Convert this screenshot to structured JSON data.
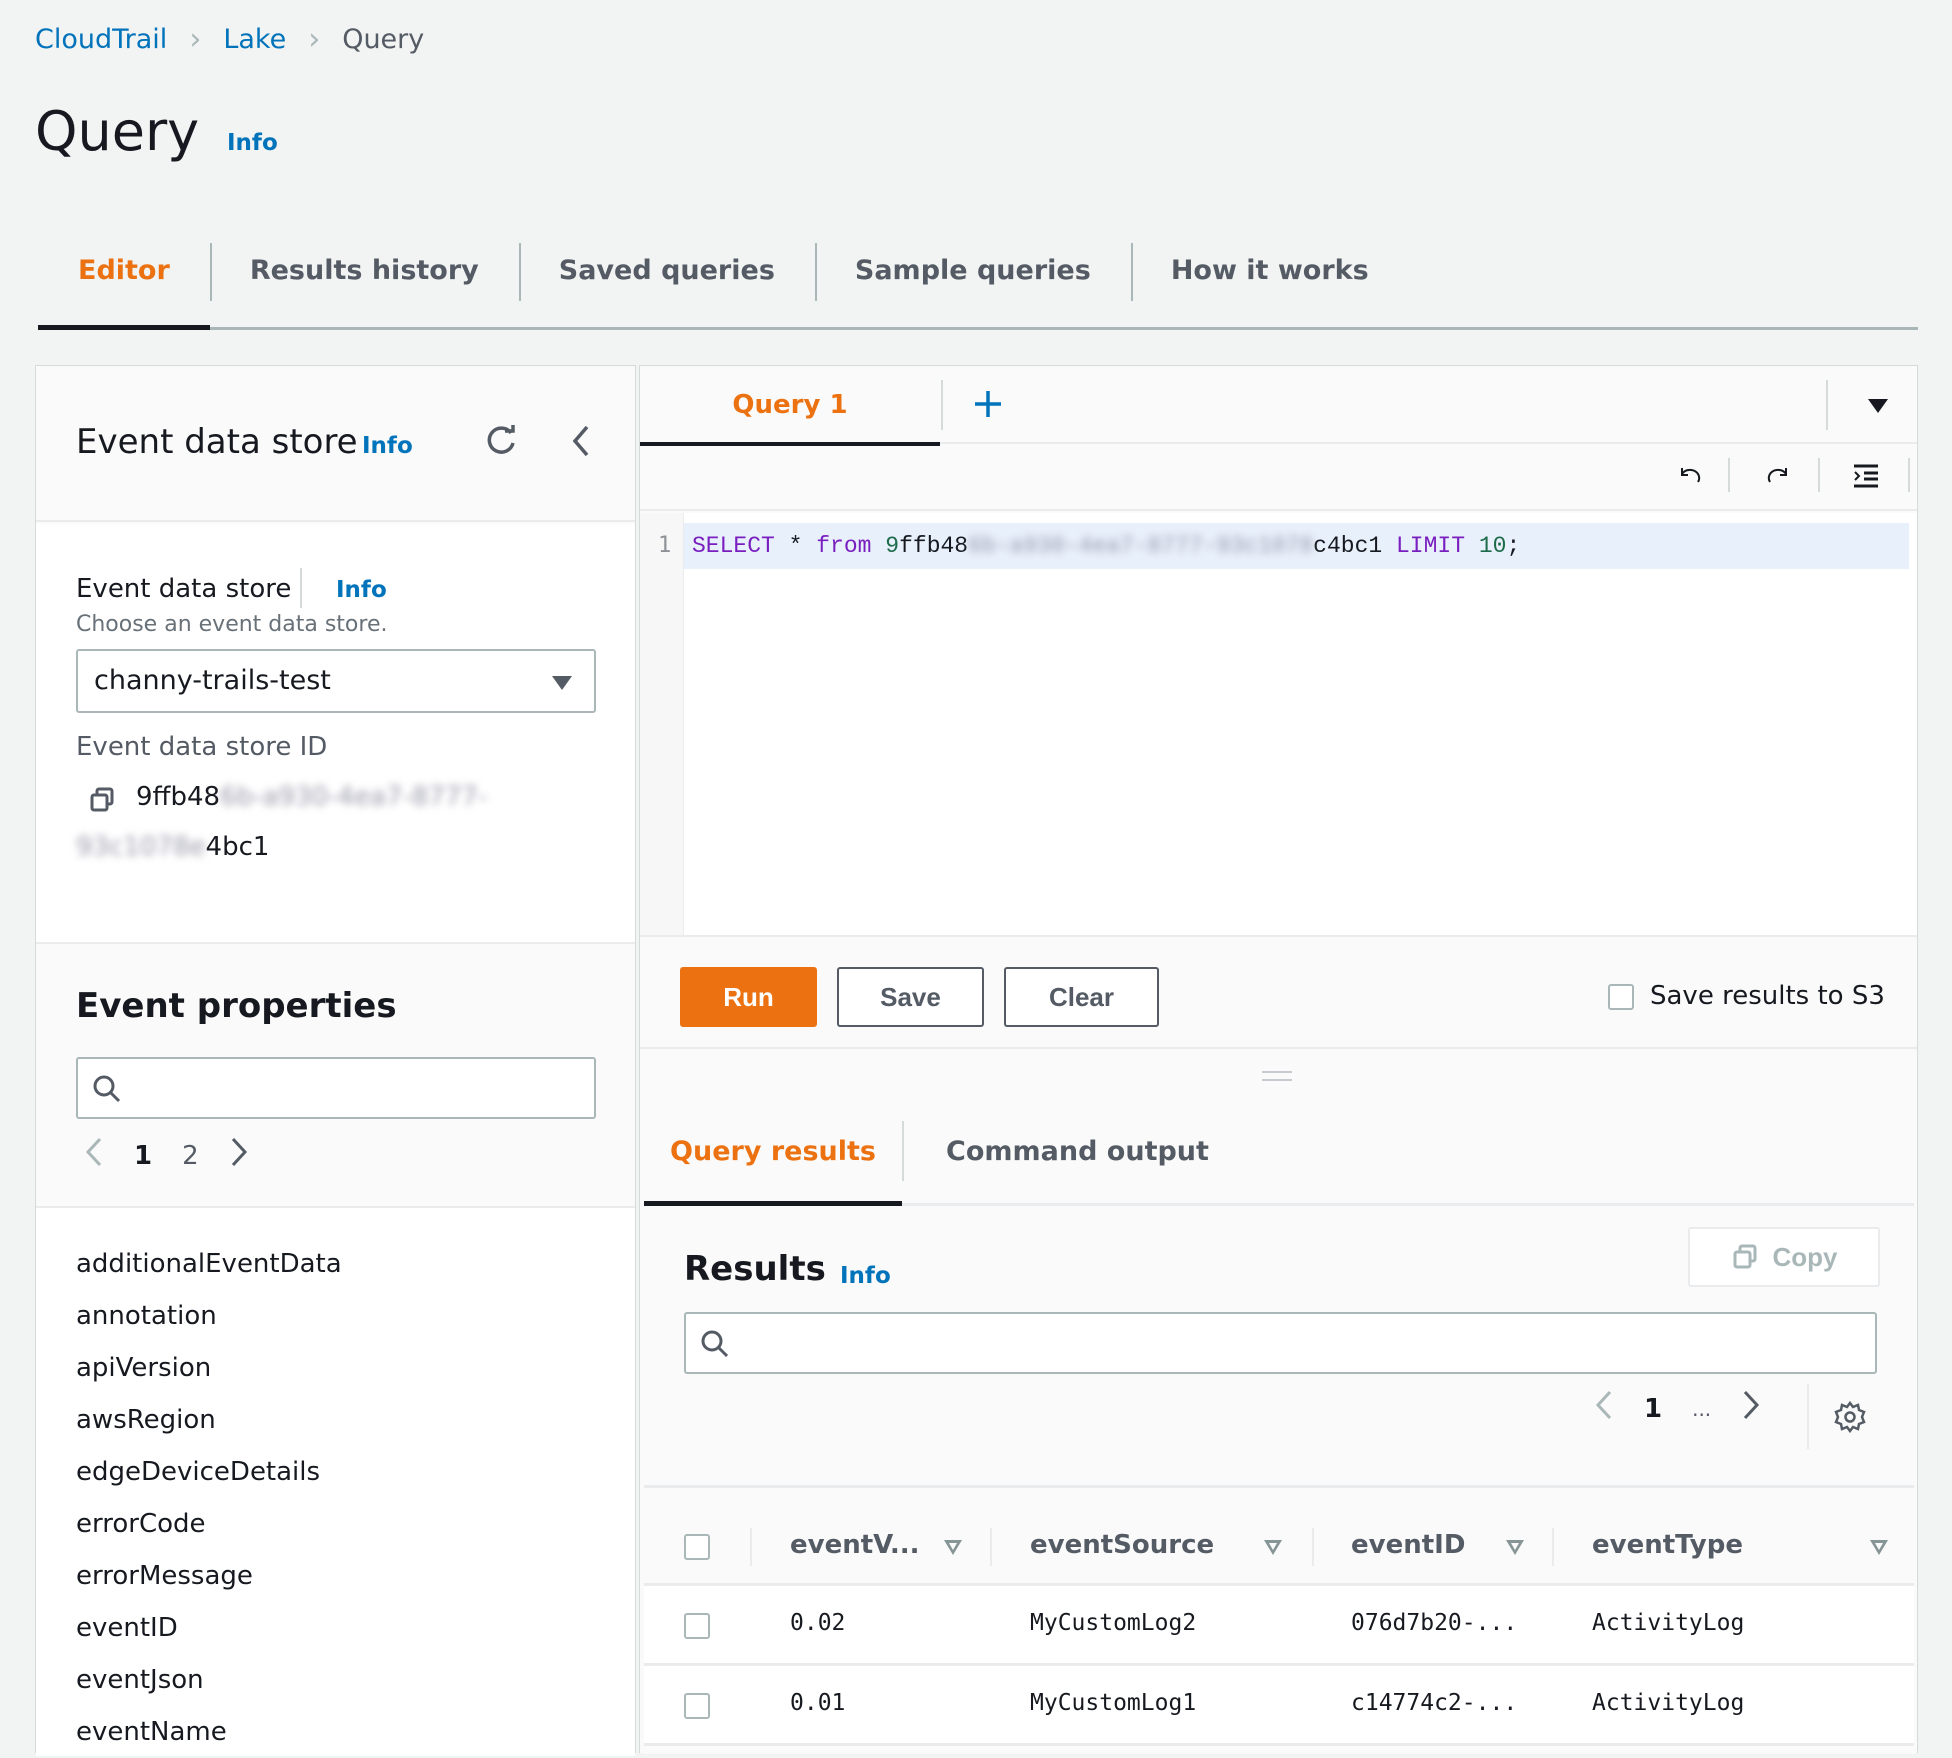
{
  "breadcrumb": [
    {
      "label": "CloudTrail",
      "link": true
    },
    {
      "label": "Lake",
      "link": true
    },
    {
      "label": "Query",
      "link": false
    }
  ],
  "page": {
    "title": "Query",
    "info": "Info"
  },
  "tabs": [
    {
      "label": "Editor",
      "active": true
    },
    {
      "label": "Results history",
      "active": false
    },
    {
      "label": "Saved queries",
      "active": false
    },
    {
      "label": "Sample queries",
      "active": false
    },
    {
      "label": "How it works",
      "active": false
    }
  ],
  "left_panel": {
    "title": "Event data store",
    "info": "Info",
    "store_label": "Event data store",
    "store_info": "Info",
    "store_description": "Choose an event data store.",
    "store_selected": "channy-trails-test",
    "id_label": "Event data store ID",
    "id_part1_visible": "9ffb48",
    "id_part1_redacted": "6b-a930-4ea7-8777-",
    "id_part2_redacted": "93c1078e",
    "id_part2_visible": "4bc1",
    "properties_title": "Event properties",
    "properties_search_placeholder": "",
    "pager": {
      "pages": [
        "1",
        "2"
      ],
      "current": "1"
    },
    "properties": [
      "additionalEventData",
      "annotation",
      "apiVersion",
      "awsRegion",
      "edgeDeviceDetails",
      "errorCode",
      "errorMessage",
      "eventID",
      "eventJson",
      "eventName"
    ]
  },
  "editor": {
    "query_tab": "Query 1",
    "line_number": "1",
    "code": {
      "select": "SELECT",
      "star": " * ",
      "from": "from",
      "id_visible_start": "9ffb48",
      "id_redacted": "6b-a930-4ea7-8777-93c1078",
      "id_visible_end": "c4bc1",
      "limit": "LIMIT",
      "limit_value": "10",
      "terminator": ";"
    }
  },
  "actions": {
    "run": "Run",
    "save": "Save",
    "clear": "Clear",
    "save_s3_label": "Save results to S3",
    "save_s3_checked": false
  },
  "results_tabs": [
    {
      "label": "Query results",
      "active": true
    },
    {
      "label": "Command output",
      "active": false
    }
  ],
  "results": {
    "title": "Results",
    "info": "Info",
    "copy_label": "Copy",
    "search_placeholder": "",
    "pager": {
      "current": "1",
      "ellipsis": "..."
    },
    "columns": [
      "eventV...",
      "eventSource",
      "eventID",
      "eventType"
    ],
    "rows": [
      [
        "0.02",
        "MyCustomLog2",
        "076d7b20-...",
        "ActivityLog"
      ],
      [
        "0.01",
        "MyCustomLog1",
        "c14774c2-...",
        "ActivityLog"
      ]
    ]
  },
  "colors": {
    "accent": "#ec7211",
    "link": "#0073bb",
    "text": "#16191f",
    "muted": "#545b64"
  }
}
